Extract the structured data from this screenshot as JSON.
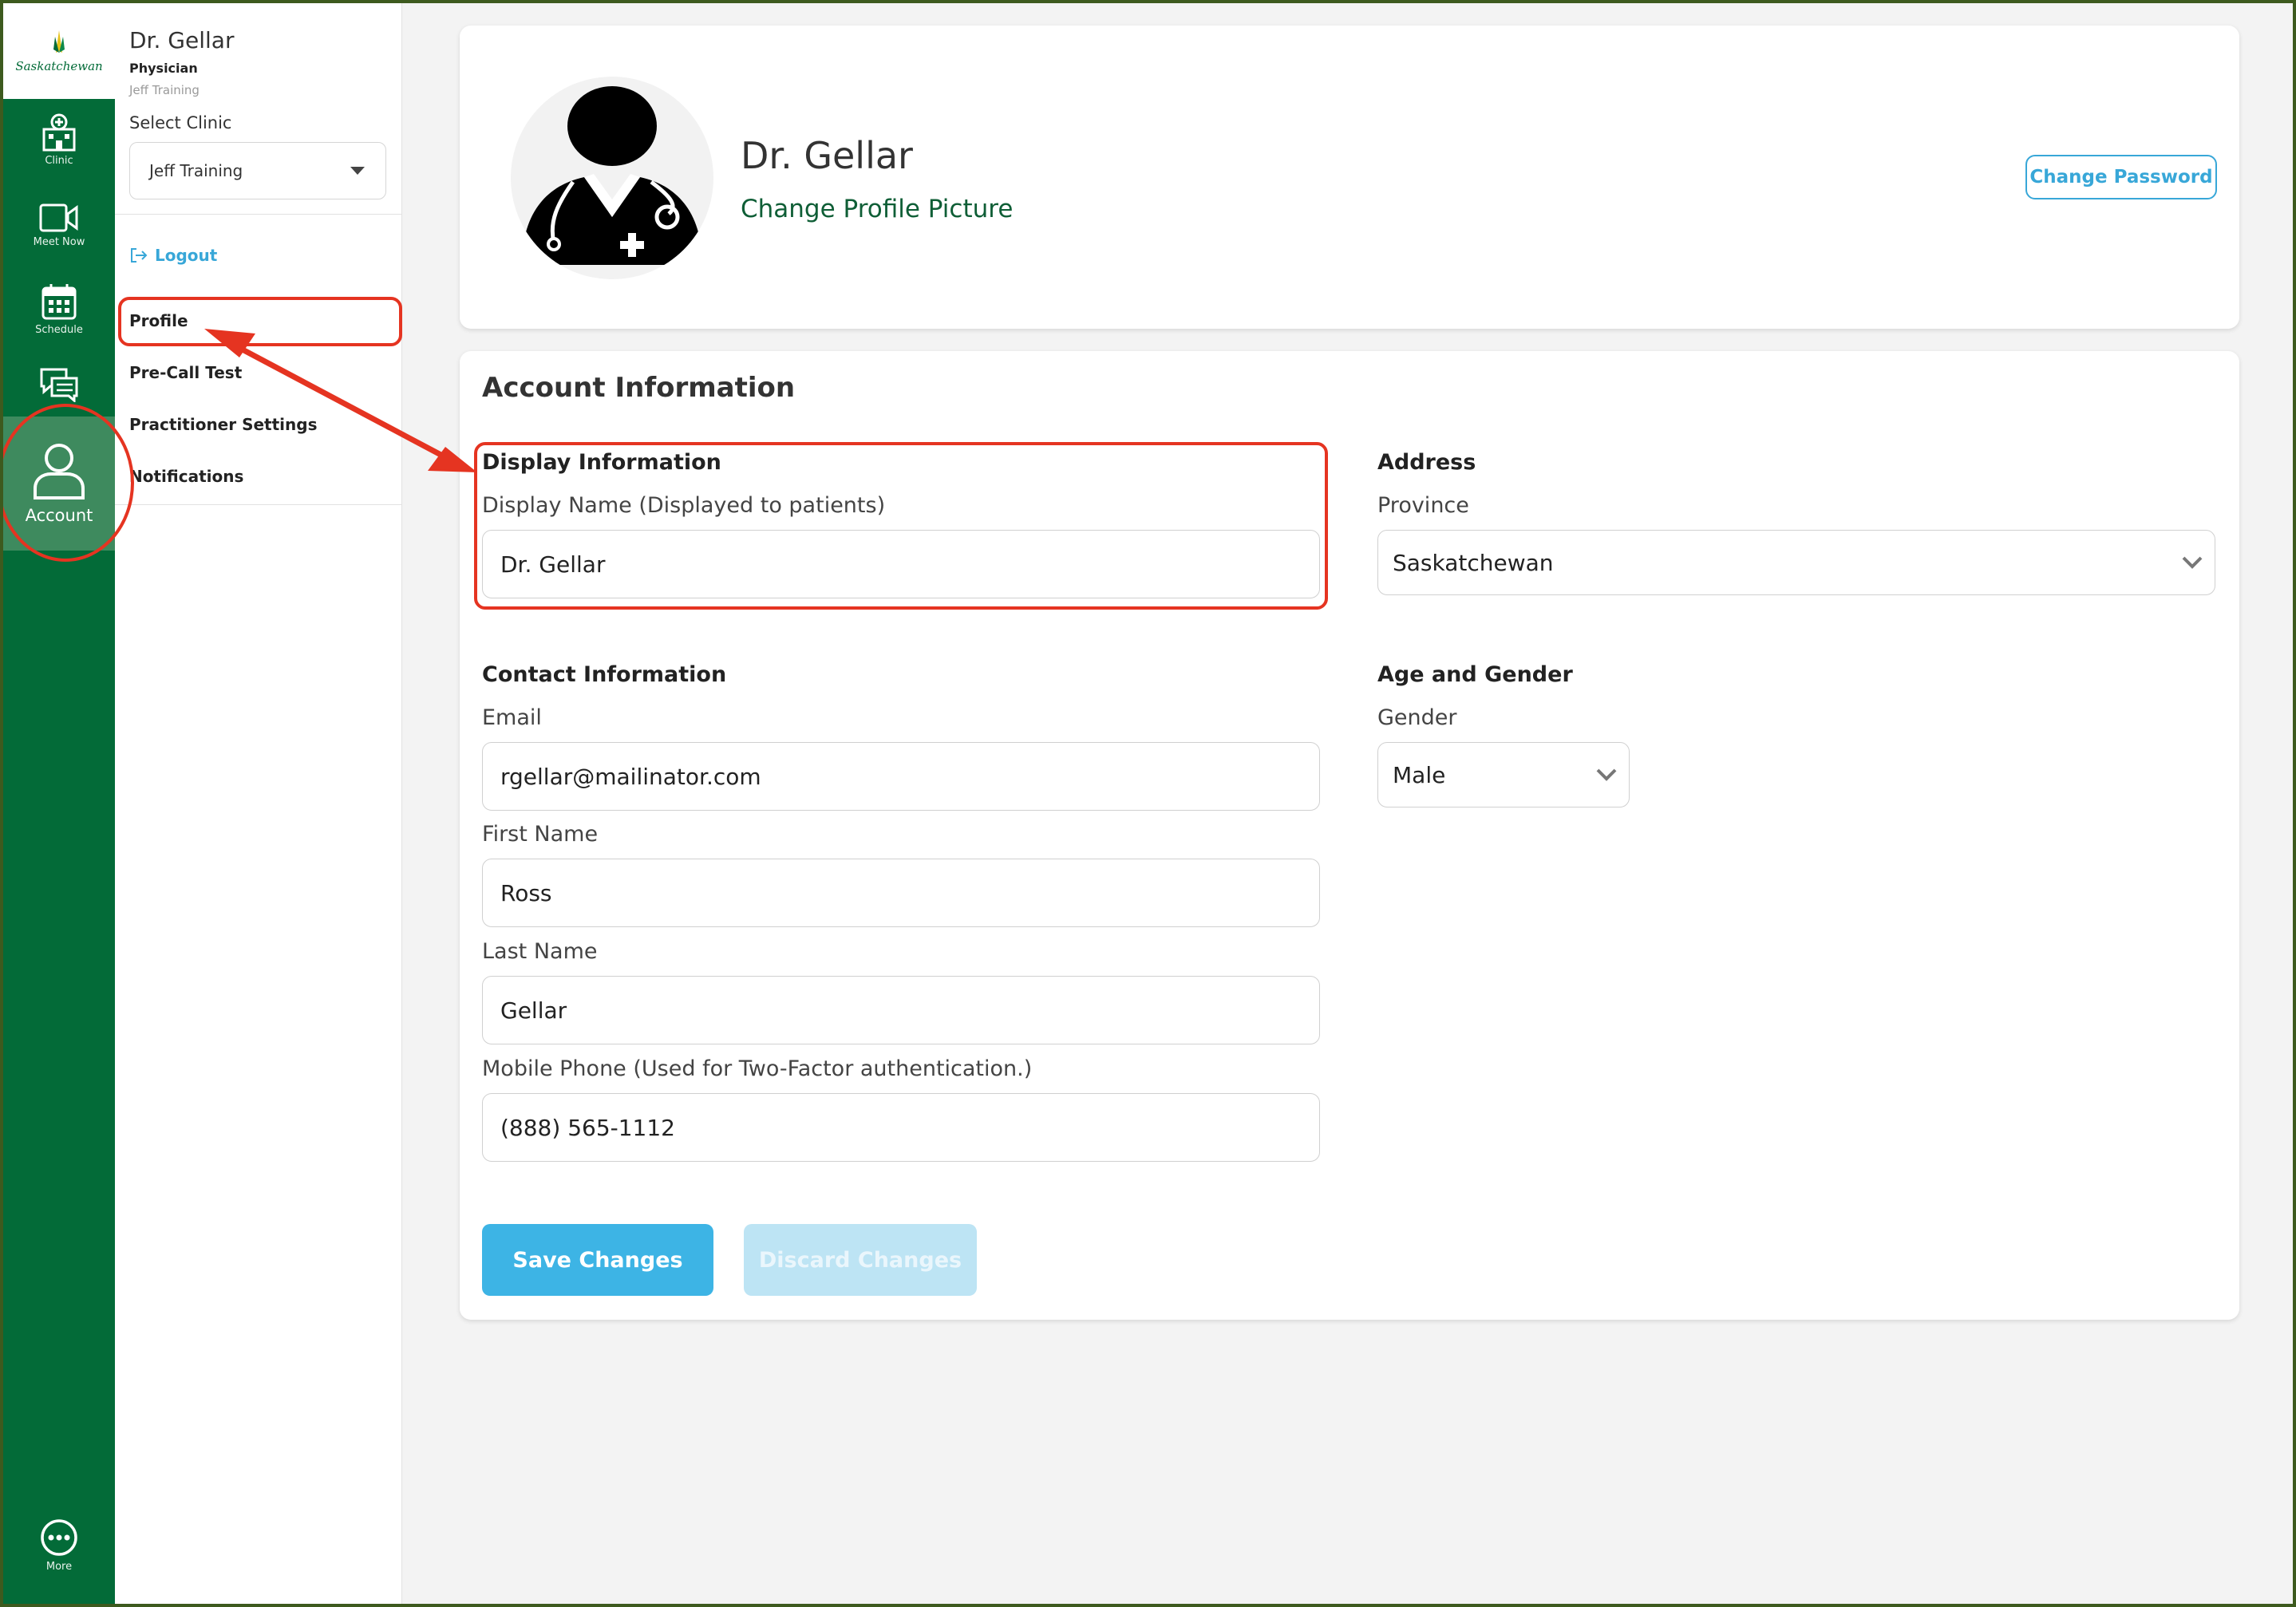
{
  "rail": {
    "logo_text": "Saskatchewan",
    "items": [
      {
        "label": "Clinic",
        "icon": "clinic-icon"
      },
      {
        "label": "Meet Now",
        "icon": "video-camera-icon"
      },
      {
        "label": "Schedule",
        "icon": "calendar-icon"
      },
      {
        "label": "",
        "icon": "chat-icon"
      },
      {
        "label": "Account",
        "icon": "user-icon",
        "active": true
      },
      {
        "label": "More",
        "icon": "more-icon"
      }
    ]
  },
  "sidebar": {
    "user_name": "Dr. Gellar",
    "user_role": "Physician",
    "clinic_subtitle": "Jeff Training",
    "select_clinic_label": "Select Clinic",
    "selected_clinic": "Jeff Training",
    "logout_label": "Logout",
    "menu": [
      {
        "label": "Profile",
        "highlighted": true
      },
      {
        "label": "Pre-Call Test"
      },
      {
        "label": "Practitioner Settings"
      },
      {
        "label": "Notifications"
      }
    ]
  },
  "profile_header": {
    "name": "Dr. Gellar",
    "change_picture_label": "Change Profile Picture",
    "change_password_label": "Change Password"
  },
  "account": {
    "title": "Account Information",
    "display": {
      "title": "Display Information",
      "display_name_label": "Display Name (Displayed to patients)",
      "display_name_value": "Dr. Gellar"
    },
    "address": {
      "title": "Address",
      "province_label": "Province",
      "province_value": "Saskatchewan"
    },
    "contact": {
      "title": "Contact Information",
      "email_label": "Email",
      "email_value": "rgellar@mailinator.com",
      "first_name_label": "First Name",
      "first_name_value": "Ross",
      "last_name_label": "Last Name",
      "last_name_value": "Gellar",
      "mobile_label": "Mobile Phone (Used for Two-Factor authentication.)",
      "mobile_value": "(888) 565-1112"
    },
    "age_gender": {
      "title": "Age and Gender",
      "gender_label": "Gender",
      "gender_value": "Male"
    },
    "save_label": "Save Changes",
    "discard_label": "Discard Changes"
  },
  "colors": {
    "rail_green": "#036b38",
    "active_green": "#3e8a5e",
    "accent_blue": "#38a7d8",
    "annotation_red": "#e53421"
  }
}
